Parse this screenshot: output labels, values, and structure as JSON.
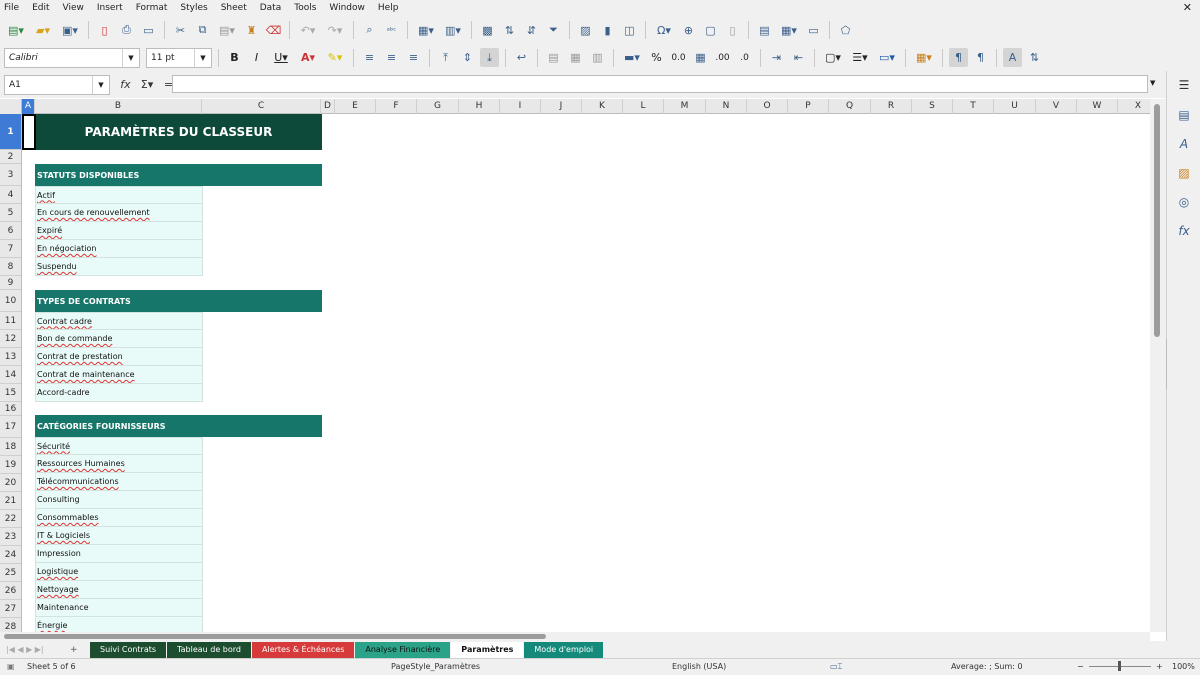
{
  "menu": [
    "File",
    "Edit",
    "View",
    "Insert",
    "Format",
    "Styles",
    "Sheet",
    "Data",
    "Tools",
    "Window",
    "Help"
  ],
  "toolbar": {
    "font_name": "Calibri",
    "font_size": "11 pt"
  },
  "formula_bar": {
    "cell_ref": "A1",
    "fx": "fx",
    "sigma": "Σ",
    "equals": "=",
    "content": ""
  },
  "columns": [
    "A",
    "B",
    "C",
    "D",
    "E",
    "F",
    "G",
    "H",
    "I",
    "J",
    "K",
    "L",
    "M",
    "N",
    "O",
    "P",
    "Q",
    "R",
    "S",
    "T",
    "U",
    "V",
    "W",
    "X"
  ],
  "rows": [
    "1",
    "2",
    "3",
    "4",
    "5",
    "6",
    "7",
    "8",
    "9",
    "10",
    "11",
    "12",
    "13",
    "14",
    "15",
    "16",
    "17",
    "18",
    "19",
    "20",
    "21",
    "22",
    "23",
    "24",
    "25",
    "26",
    "27",
    "28"
  ],
  "sheet": {
    "title": "PARAMÈTRES DU CLASSEUR",
    "sections": [
      {
        "header": "STATUTS DISPONIBLES",
        "items": [
          "Actif",
          "En cours de renouvellement",
          "Expiré",
          "En négociation",
          "Suspendu"
        ]
      },
      {
        "header": "TYPES DE CONTRATS",
        "items": [
          "Contrat cadre",
          "Bon de commande",
          "Contrat de prestation",
          "Contrat de maintenance",
          "Accord-cadre"
        ]
      },
      {
        "header": "CATÉGORIES FOURNISSEURS",
        "items": [
          "Sécurité",
          "Ressources Humaines",
          "Télécommunications",
          "Consulting",
          "Consommables",
          "IT & Logiciels",
          "Impression",
          "Logistique",
          "Nettoyage",
          "Maintenance",
          "Énergie"
        ]
      }
    ]
  },
  "tabs": [
    {
      "label": "Suivi Contrats",
      "color": "#1c4d2e"
    },
    {
      "label": "Tableau de bord",
      "color": "#1c4d2e"
    },
    {
      "label": "Alertes & Échéances",
      "color": "#d63a3a"
    },
    {
      "label": "Analyse Financière",
      "color": "#2aa389"
    },
    {
      "label": "Paramètres",
      "color": "#ffffff"
    },
    {
      "label": "Mode d'emploi",
      "color": "#168a7a"
    }
  ],
  "status": {
    "sheet": "Sheet 5 of 6",
    "page_style": "PageStyle_Paramètres",
    "language": "English (USA)",
    "summary": "Average: ; Sum: 0",
    "zoom": "100%"
  },
  "colors": {
    "title_bg": "#0d4a3a",
    "section_bg": "#17766a",
    "item_bg": "#e9fbf8",
    "selection": "#3d7bd6"
  }
}
